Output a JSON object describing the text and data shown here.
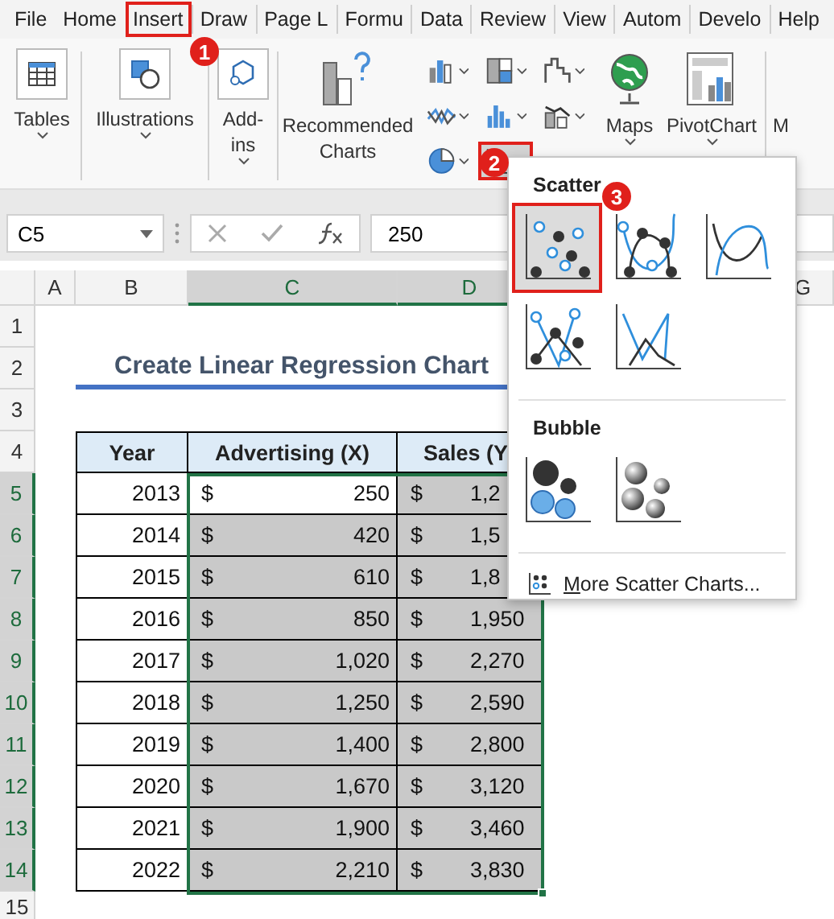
{
  "tabs": [
    {
      "label": "File",
      "selected": false
    },
    {
      "label": "Home",
      "selected": false
    },
    {
      "label": "Insert",
      "selected": true
    },
    {
      "label": "Draw",
      "selected": false
    },
    {
      "label": "Page L",
      "selected": false
    },
    {
      "label": "Formu",
      "selected": false
    },
    {
      "label": "Data",
      "selected": false
    },
    {
      "label": "Review",
      "selected": false
    },
    {
      "label": "View",
      "selected": false
    },
    {
      "label": "Autom",
      "selected": false
    },
    {
      "label": "Develo",
      "selected": false
    },
    {
      "label": "Help",
      "selected": false
    }
  ],
  "ribbon": {
    "large_buttons_left": [
      {
        "kind": "tables",
        "label": "Tables"
      },
      {
        "kind": "illustrations",
        "label": "Illustrations"
      },
      {
        "kind": "addins",
        "label": "Add-ins"
      }
    ],
    "recommended": "Recommended Charts",
    "chart_buttons": [
      {
        "kind": "column",
        "selected": false
      },
      {
        "kind": "hierarchy",
        "selected": false
      },
      {
        "kind": "waterfall",
        "selected": false
      },
      {
        "kind": "line",
        "selected": false
      },
      {
        "kind": "statistic",
        "selected": false
      },
      {
        "kind": "combo",
        "selected": false
      },
      {
        "kind": "pie",
        "selected": false
      },
      {
        "kind": "scatter",
        "selected": true
      }
    ],
    "large_buttons_right": [
      {
        "kind": "maps",
        "label": "Maps"
      },
      {
        "kind": "pivotchart",
        "label": "PivotChart"
      }
    ],
    "cut_label": "M"
  },
  "formula_bar": {
    "name_box": "C5",
    "value": "250"
  },
  "column_headers": [
    {
      "label": "A",
      "selected": false
    },
    {
      "label": "B",
      "selected": false
    },
    {
      "label": "C",
      "selected": true
    },
    {
      "label": "D",
      "selected": true
    },
    {
      "label": "G",
      "selected": false
    }
  ],
  "row_headers": [
    {
      "label": "1",
      "selected": false
    },
    {
      "label": "2",
      "selected": false
    },
    {
      "label": "3",
      "selected": false
    },
    {
      "label": "4",
      "selected": false
    },
    {
      "label": "5",
      "selected": true
    },
    {
      "label": "6",
      "selected": true
    },
    {
      "label": "7",
      "selected": true
    },
    {
      "label": "8",
      "selected": true
    },
    {
      "label": "9",
      "selected": true
    },
    {
      "label": "10",
      "selected": true
    },
    {
      "label": "11",
      "selected": true
    },
    {
      "label": "12",
      "selected": true
    },
    {
      "label": "13",
      "selected": true
    },
    {
      "label": "14",
      "selected": true
    },
    {
      "label": "15",
      "selected": false
    }
  ],
  "sheet": {
    "title": "Create Linear Regression Chart",
    "table_headers": [
      "Year",
      "Advertising (X)",
      "Sales (Y"
    ],
    "rows": [
      {
        "year": "2013",
        "adv_currency": "$",
        "adv": "250",
        "sales_currency": "$",
        "sales": "1,2",
        "active": true
      },
      {
        "year": "2014",
        "adv_currency": "$",
        "adv": "420",
        "sales_currency": "$",
        "sales": "1,5",
        "active": false
      },
      {
        "year": "2015",
        "adv_currency": "$",
        "adv": "610",
        "sales_currency": "$",
        "sales": "1,8",
        "active": false
      },
      {
        "year": "2016",
        "adv_currency": "$",
        "adv": "850",
        "sales_currency": "$",
        "sales": "1,950",
        "active": false
      },
      {
        "year": "2017",
        "adv_currency": "$",
        "adv": "1,020",
        "sales_currency": "$",
        "sales": "2,270",
        "active": false
      },
      {
        "year": "2018",
        "adv_currency": "$",
        "adv": "1,250",
        "sales_currency": "$",
        "sales": "2,590",
        "active": false
      },
      {
        "year": "2019",
        "adv_currency": "$",
        "adv": "1,400",
        "sales_currency": "$",
        "sales": "2,800",
        "active": false
      },
      {
        "year": "2020",
        "adv_currency": "$",
        "adv": "1,670",
        "sales_currency": "$",
        "sales": "3,120",
        "active": false
      },
      {
        "year": "2021",
        "adv_currency": "$",
        "adv": "1,900",
        "sales_currency": "$",
        "sales": "3,460",
        "active": false
      },
      {
        "year": "2022",
        "adv_currency": "$",
        "adv": "2,210",
        "sales_currency": "$",
        "sales": "3,830",
        "active": false
      }
    ]
  },
  "scatter_menu": {
    "sections": [
      {
        "title": "Scatter",
        "items": [
          {
            "kind": "markers",
            "selected": true
          },
          {
            "kind": "smooth_markers",
            "selected": false
          },
          {
            "kind": "smooth",
            "selected": false
          },
          {
            "kind": "straight_markers",
            "selected": false
          },
          {
            "kind": "straight",
            "selected": false
          }
        ]
      },
      {
        "title": "Bubble",
        "items": [
          {
            "kind": "bubble",
            "selected": false
          },
          {
            "kind": "bubble3d",
            "selected": false
          }
        ]
      }
    ],
    "more": "More Scatter Charts..."
  },
  "step_badges": [
    "1",
    "2",
    "3"
  ]
}
